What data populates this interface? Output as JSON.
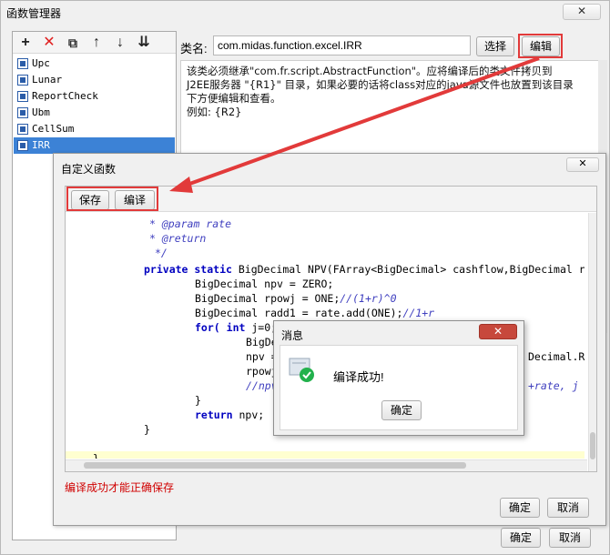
{
  "main_window": {
    "title": "函数管理器",
    "close_glyph": "✕",
    "ok_label": "确定",
    "cancel_label": "取消"
  },
  "toolbar": {
    "add_glyph": "+",
    "delete_glyph": "✕",
    "copy_glyph": "⧉",
    "up_glyph": "↑",
    "down_glyph": "↓",
    "import_glyph": "⇊"
  },
  "function_list": {
    "items": [
      "Upc",
      "Lunar",
      "ReportCheck",
      "Ubm",
      "CellSum",
      "IRR"
    ],
    "selected": "IRR"
  },
  "class_panel": {
    "label": "类名:",
    "class_name": "com.midas.function.excel.IRR",
    "choose_label": "选择",
    "edit_label": "编辑",
    "description_lines": [
      "该类必须继承\"com.fr.script.AbstractFunction\"。应将编译后的类文件拷贝到",
      "J2EE服务器 \"{R1}\" 目录，如果必要的话将class对应的java源文件也放置到该目录",
      "下方便编辑和查看。",
      "例如: {R2}"
    ]
  },
  "func_dialog": {
    "title": "自定义函数",
    "close_glyph": "✕",
    "save_label": "保存",
    "compile_label": "编译",
    "tip": "编译成功才能正确保存",
    "ok_label": "确定",
    "cancel_label": "取消",
    "code": {
      "l1_cm": "* @param rate",
      "l2_cm": "* @return",
      "l3_cm": "*/",
      "l4_kw1": "private static",
      "l4_rest": " BigDecimal NPV(FArray<BigDecimal> cashflow,BigDecimal r",
      "l5": "BigDecimal npv = ZERO;",
      "l6_code": "BigDecimal rpowj = ONE;",
      "l6_cm": "//(1+r)^0",
      "l7_code": "BigDecimal radd1 = rate.add(ONE);",
      "l7_cm": "//1+r",
      "l8_kw": "for(",
      "l8_kw2": "int",
      "l8_rest": " j=0;",
      "l9": "BigDe",
      "l10": "npv =",
      "l10_right": "Decimal.RO",
      "l11": "rpowj",
      "l12_cm": "//npv",
      "l12_right": "+rate, j );",
      "l13": "}",
      "l14_kw": "return",
      "l14_rest": " npv;",
      "l15": "}",
      "l16": "}"
    }
  },
  "message_dialog": {
    "title": "消息",
    "close_glyph": "✕",
    "text": "编译成功!",
    "ok_label": "确定"
  },
  "colors": {
    "selection": "#3c82d6",
    "annotation_red": "#e23a3a",
    "keyword": "#0000c0",
    "comment": "#3f3fbf",
    "success_green": "#22b14c"
  }
}
